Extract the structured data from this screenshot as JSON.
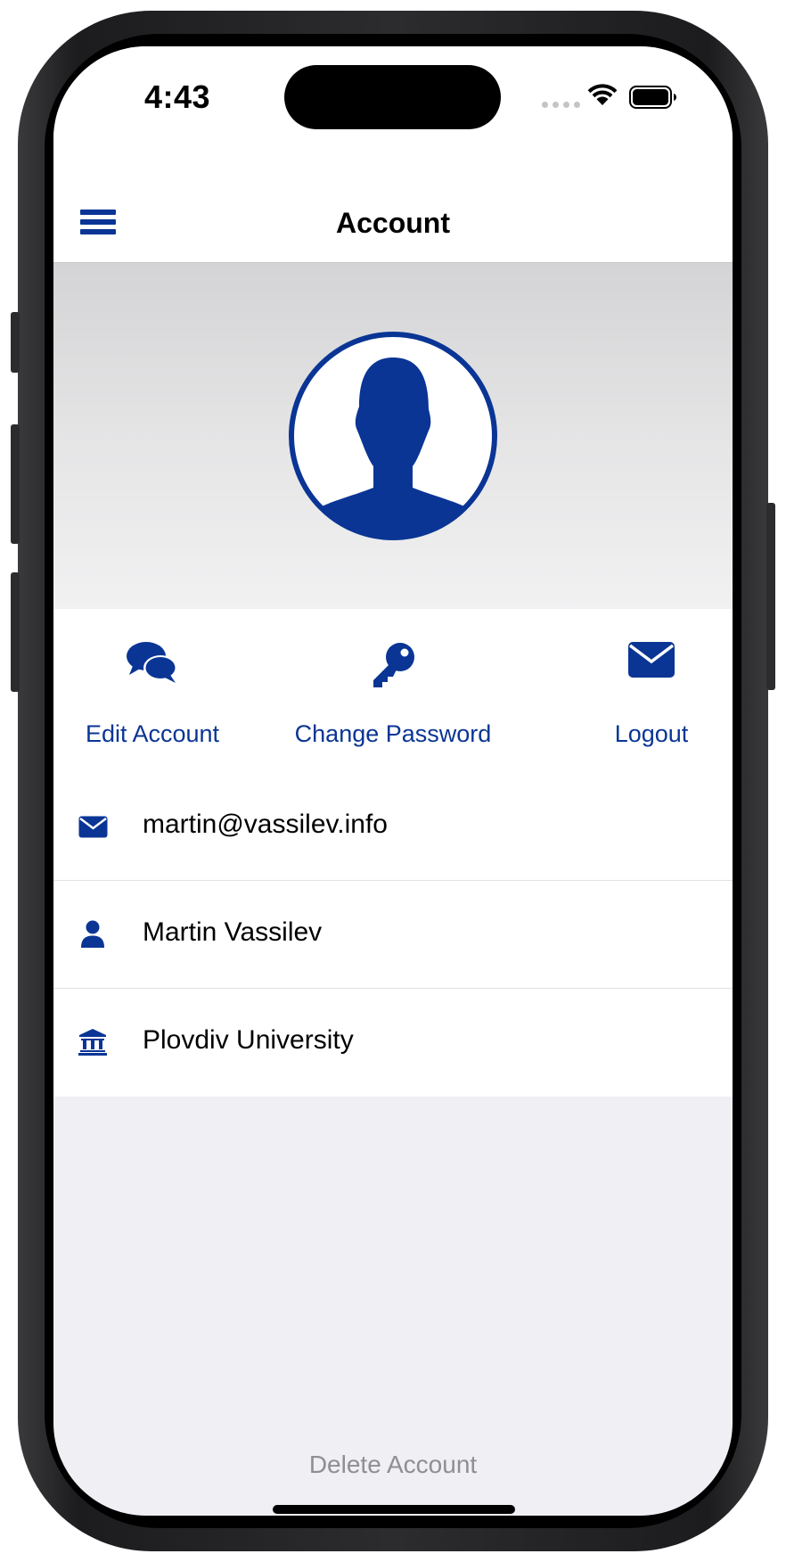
{
  "status_bar": {
    "time": "4:43"
  },
  "nav": {
    "title": "Account",
    "menu_icon": "hamburger-menu-icon"
  },
  "profile": {
    "avatar_icon": "user-silhouette-icon"
  },
  "actions": [
    {
      "label": "Edit Account",
      "icon": "chat-bubbles-icon"
    },
    {
      "label": "Change Password",
      "icon": "key-icon"
    },
    {
      "label": "Logout",
      "icon": "envelope-icon"
    }
  ],
  "info": {
    "email": {
      "value": "martin@vassilev.info",
      "icon": "envelope-icon"
    },
    "name": {
      "value": "Martin Vassilev",
      "icon": "person-icon"
    },
    "institution": {
      "value": "Plovdiv University",
      "icon": "university-icon"
    }
  },
  "delete_label": "Delete Account",
  "colors": {
    "accent": "#0a3595",
    "muted": "#8e8e93",
    "background": "#efeff4"
  }
}
